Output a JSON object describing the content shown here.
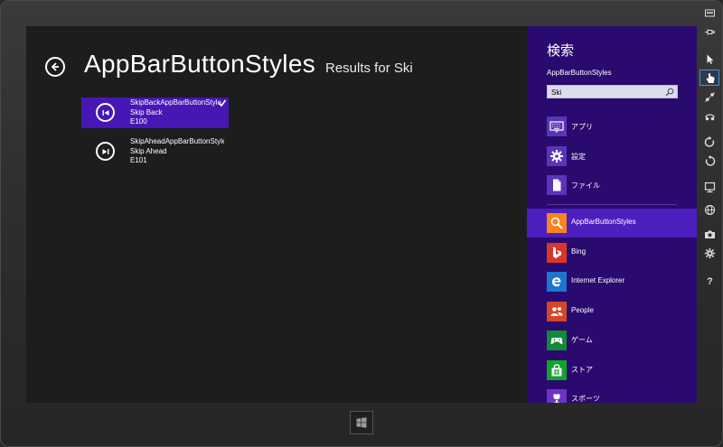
{
  "app": {
    "title": "AppBarButtonStyles",
    "results_for": "Results for Ski"
  },
  "results": [
    {
      "name": "SkipBackAppBarButtonStyle",
      "label": "Skip Back",
      "code": "E100",
      "icon": "skip-back-icon",
      "selected": true
    },
    {
      "name": "SkipAheadAppBarButtonStyle",
      "label": "Skip Ahead",
      "code": "E101",
      "icon": "skip-ahead-icon",
      "selected": false
    }
  ],
  "charm": {
    "title": "検索",
    "current_app": "AppBarButtonStyles",
    "query": "Ski",
    "scopes": [
      {
        "label": "アプリ",
        "icon": "keyboard-icon"
      },
      {
        "label": "設定",
        "icon": "gear-icon"
      },
      {
        "label": "ファイル",
        "icon": "file-icon"
      }
    ],
    "apps": [
      {
        "label": "AppBarButtonStyles",
        "icon": "search-icon",
        "color": "#f7841e",
        "selected": true
      },
      {
        "label": "Bing",
        "icon": "bing-icon",
        "color": "#d8362a",
        "selected": false
      },
      {
        "label": "Internet Explorer",
        "icon": "ie-icon",
        "color": "#1c76d0",
        "selected": false
      },
      {
        "label": "People",
        "icon": "people-icon",
        "color": "#d24726",
        "selected": false
      },
      {
        "label": "ゲーム",
        "icon": "gamepad-icon",
        "color": "#128a3a",
        "selected": false
      },
      {
        "label": "ストア",
        "icon": "store-icon",
        "color": "#11a32b",
        "selected": false
      },
      {
        "label": "スポーツ",
        "icon": "trophy-icon",
        "color": "#6a34c6",
        "selected": false
      }
    ]
  },
  "colors": {
    "charm_bg": "#2a0a6e",
    "selection": "#4617b4",
    "scope_tile": "#5a34b8"
  },
  "toolbar": [
    "minimize-icon",
    "pin-icon",
    "pointer-icon",
    "touch-icon",
    "pinch-icon",
    "rotate-gesture-icon",
    "rotate-clockwise-icon",
    "rotate-counterclockwise-icon",
    "resolution-icon",
    "location-icon",
    "camera-icon",
    "settings-icon",
    "help-icon"
  ]
}
